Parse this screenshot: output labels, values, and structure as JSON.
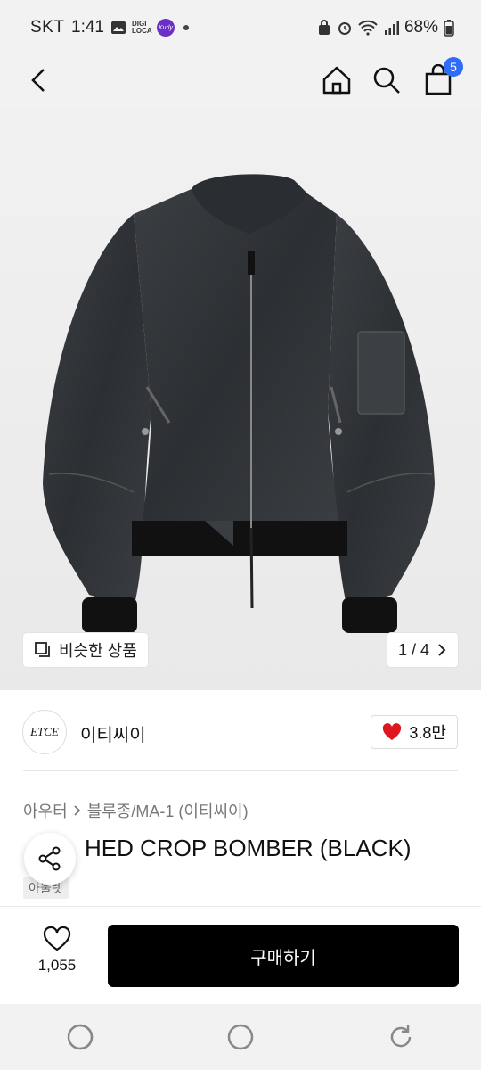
{
  "status_bar": {
    "carrier": "SKT",
    "time": "1:41",
    "digi_loca": "DIGI LOCA",
    "kurly": "Kurly",
    "battery": "68%"
  },
  "header": {
    "cart_count": "5"
  },
  "product_image": {
    "similar_label": "비슷한 상품",
    "counter": "1 / 4"
  },
  "brand": {
    "logo_text": "ETCE",
    "name": "이티씨이",
    "likes": "3.8만"
  },
  "category": {
    "parent": "아우터",
    "child": "블루종/MA-1 (이티씨이)"
  },
  "product": {
    "title": "WASHED CROP BOMBER (BLACK)",
    "title_visible": "HED CROP BOMBER (BLACK)",
    "tag": "아울렛"
  },
  "bottom": {
    "wish_count": "1,055",
    "buy_label": "구매하기"
  },
  "colors": {
    "badge": "#2f6df6",
    "heart": "#e0161e",
    "buy_button": "#000000"
  }
}
